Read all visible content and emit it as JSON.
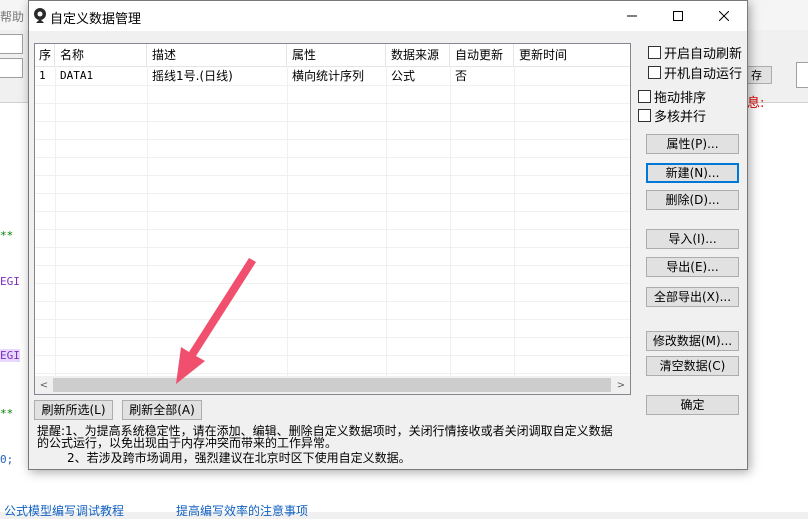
{
  "background": {
    "menu_fragment": "帮助",
    "right_button": "存",
    "red_fragment": "息:",
    "code_fragments": [
      "**",
      "EGI",
      "EGI",
      "**",
      "0;"
    ],
    "status_links": [
      "公式模型编写调试教程",
      "提高编写效率的注意事项"
    ]
  },
  "dialog": {
    "title": "自定义数据管理",
    "controls": {
      "minimize": "—",
      "maximize": "☐",
      "close": "✕"
    },
    "list": {
      "columns": [
        "序",
        "名称",
        "描述",
        "属性",
        "数据来源",
        "自动更新",
        "更新时间"
      ],
      "rows": [
        {
          "idx": "1",
          "name": "DATA1",
          "desc": "摇线1号.(日线)",
          "attr": "横向统计序列",
          "source": "公式",
          "auto": "否",
          "time": ""
        }
      ]
    },
    "scroll": {
      "left": "<",
      "right": ">"
    },
    "checkboxes": [
      {
        "label": "开启自动刷新",
        "checked": false
      },
      {
        "label": "开机自动运行",
        "checked": false
      },
      {
        "label": "拖动排序",
        "checked": false
      },
      {
        "label": "多核并行",
        "checked": false
      }
    ],
    "buttons": {
      "properties": "属性(P)...",
      "new": "新建(N)...",
      "delete": "删除(D)...",
      "import": "导入(I)...",
      "export": "导出(E)...",
      "export_all": "全部导出(X)...",
      "modify": "修改数据(M)...",
      "clear": "清空数据(C)",
      "ok": "确定",
      "refresh_selected": "刷新所选(L)",
      "refresh_all": "刷新全部(A)"
    },
    "notice": {
      "line1": "提醒:1、为提高系统稳定性，请在添加、编辑、删除自定义数据项时，关闭行情接收或者关闭调取自定义数据的公式运行，以免出现由于内存冲突而带来的工作异常。",
      "line2": "2、若涉及跨市场调用，强烈建议在北京时区下使用自定义数据。"
    }
  },
  "colors": {
    "arrow": "#f0506e",
    "accent": "#0078d7"
  }
}
